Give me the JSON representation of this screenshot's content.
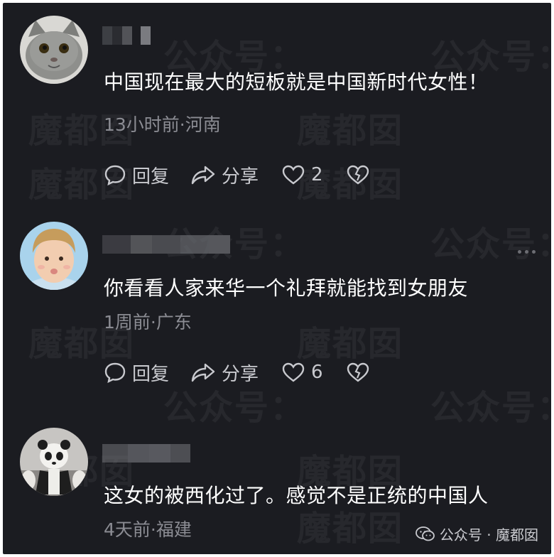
{
  "watermark": {
    "text_a": "魔都囡",
    "text_b": "公众号："
  },
  "comments": [
    {
      "avatar": "cat-avatar",
      "text": "中国现在最大的短板就是中国新时代女性！",
      "meta": "13小时前·河南",
      "reply_label": "回复",
      "share_label": "分享",
      "like_count": "2"
    },
    {
      "avatar": "child-avatar",
      "text": "你看看人家来华一个礼拜就能找到女朋友",
      "meta": "1周前·广东",
      "reply_label": "回复",
      "share_label": "分享",
      "like_count": "6"
    },
    {
      "avatar": "panda-avatar",
      "text": "这女的被西化过了。感觉不是正统的中国人",
      "meta": "4天前·福建"
    }
  ],
  "footer": {
    "label": "公众号 · 魔都囡"
  },
  "colors": {
    "background": "#1b1c21",
    "text": "#ffffff",
    "meta": "#8b8c93"
  }
}
